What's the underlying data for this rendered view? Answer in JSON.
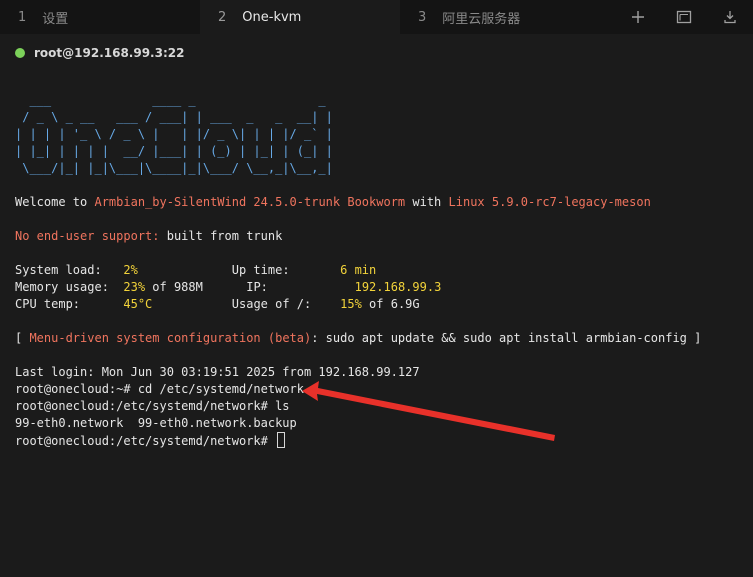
{
  "tabs": [
    {
      "num": "1",
      "label": "设置"
    },
    {
      "num": "2",
      "label": "One-kvm"
    },
    {
      "num": "3",
      "label": "阿里云服务器"
    }
  ],
  "tab_icons": [
    "plus-icon",
    "window-icon",
    "download-icon"
  ],
  "session": {
    "host": "root@192.168.99.3:22",
    "status_color": "#7cd15a"
  },
  "terminal": {
    "art": [
      "  ___              ____ _                 _",
      " / _ \\ _ __   ___ / ___| | ___  _   _  __| |",
      "| | | | '_ \\ / _ \\ |   | |/ _ \\| | | |/ _` |",
      "| |_| | | | |  __/ |___| | (_) | |_| | (_| |",
      " \\___/|_| |_|\\___|\\____|_|\\___/ \\__,_|\\__,_|"
    ],
    "welcome_pre": "Welcome to ",
    "welcome_dist": "Armbian_by-SilentWind 24.5.0-trunk Bookworm",
    "welcome_mid": " with ",
    "welcome_kernel": "Linux 5.9.0-rc7-legacy-meson",
    "support_label": "No end-user support:",
    "support_text": " built from trunk",
    "sys_load_label": "System load:   ",
    "sys_load_val": "2%",
    "uptime_label": "Up time:       ",
    "uptime_val": "6 min",
    "mem_label": "Memory usage:  ",
    "mem_val": "23%",
    "mem_rest": " of 988M",
    "ip_label": "IP:            ",
    "ip_val": "192.168.99.3",
    "cpu_label": "CPU temp:      ",
    "cpu_val": "45°C",
    "usage_label": "Usage of /:    ",
    "usage_val": "15%",
    "usage_rest": " of 6.9G",
    "menu_open": "[ ",
    "menu_text": "Menu-driven system configuration (beta)",
    "menu_cmd": ": sudo apt update && sudo apt install armbian-config ]",
    "last_login": "Last login: Mon Jun 30 03:19:51 2025 from 192.168.99.127",
    "cmd1": "root@onecloud:~# cd /etc/systemd/network",
    "cmd2": "root@onecloud:/etc/systemd/network# ls",
    "ls_output": "99-eth0.network  99-eth0.network.backup",
    "prompt": "root@onecloud:/etc/systemd/network# "
  },
  "annotation": {
    "color": "#e8312a"
  }
}
